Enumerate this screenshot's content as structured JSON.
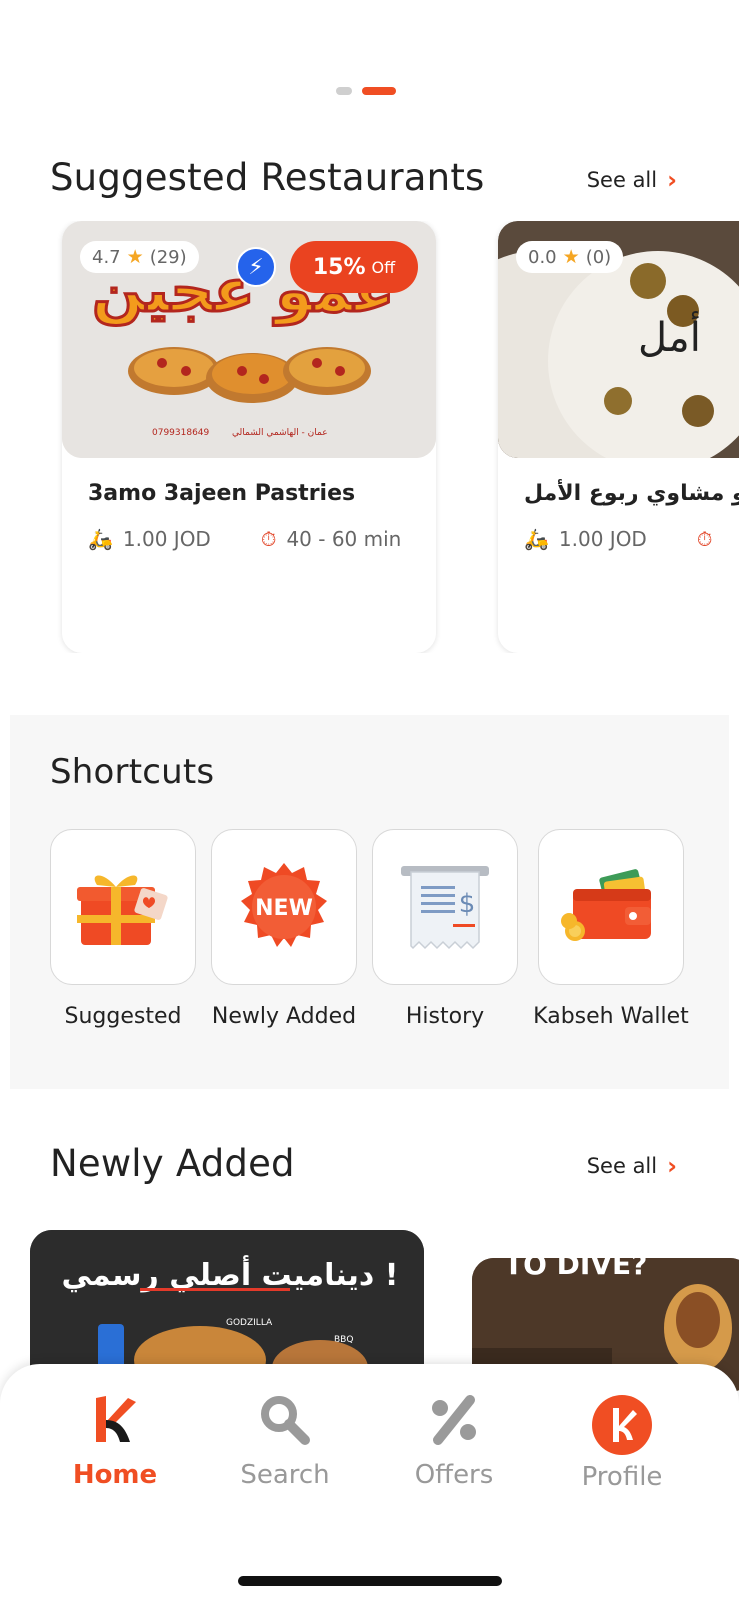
{
  "suggested": {
    "title": "Suggested Restaurants",
    "see_all": "See all",
    "restaurants": [
      {
        "name": "3amo 3ajeen Pastries",
        "rating": "4.7",
        "reviews": "(29)",
        "discount_pct": "15%",
        "discount_off": "Off",
        "delivery_fee": "1.00 JOD",
        "time": "40 - 60 min"
      },
      {
        "name": "ملحمة و مشاوي ربوع الأمل",
        "rating": "0.0",
        "reviews": "(0)",
        "delivery_fee": "1.00 JOD"
      }
    ]
  },
  "shortcuts": {
    "title": "Shortcuts",
    "items": [
      {
        "label": "Suggested",
        "icon": "gift-icon"
      },
      {
        "label": "Newly Added",
        "icon": "new-badge-icon"
      },
      {
        "label": "History",
        "icon": "receipt-icon"
      },
      {
        "label": "Kabseh Wallet",
        "icon": "wallet-icon"
      }
    ]
  },
  "newly_added": {
    "title": "Newly Added",
    "see_all": "See all",
    "banner1_text": "ديناميت أصلي رسمي !",
    "banner1_sub": "GODZILLA",
    "banner1_sub2": "BBQ",
    "banner2_text": "TO DIVE?"
  },
  "nav": {
    "items": [
      {
        "label": "Home",
        "active": true
      },
      {
        "label": "Search"
      },
      {
        "label": "Offers"
      },
      {
        "label": "Profile"
      }
    ]
  },
  "colors": {
    "accent": "#f04e23",
    "flash": "#2563eb",
    "star": "#f5a623"
  }
}
